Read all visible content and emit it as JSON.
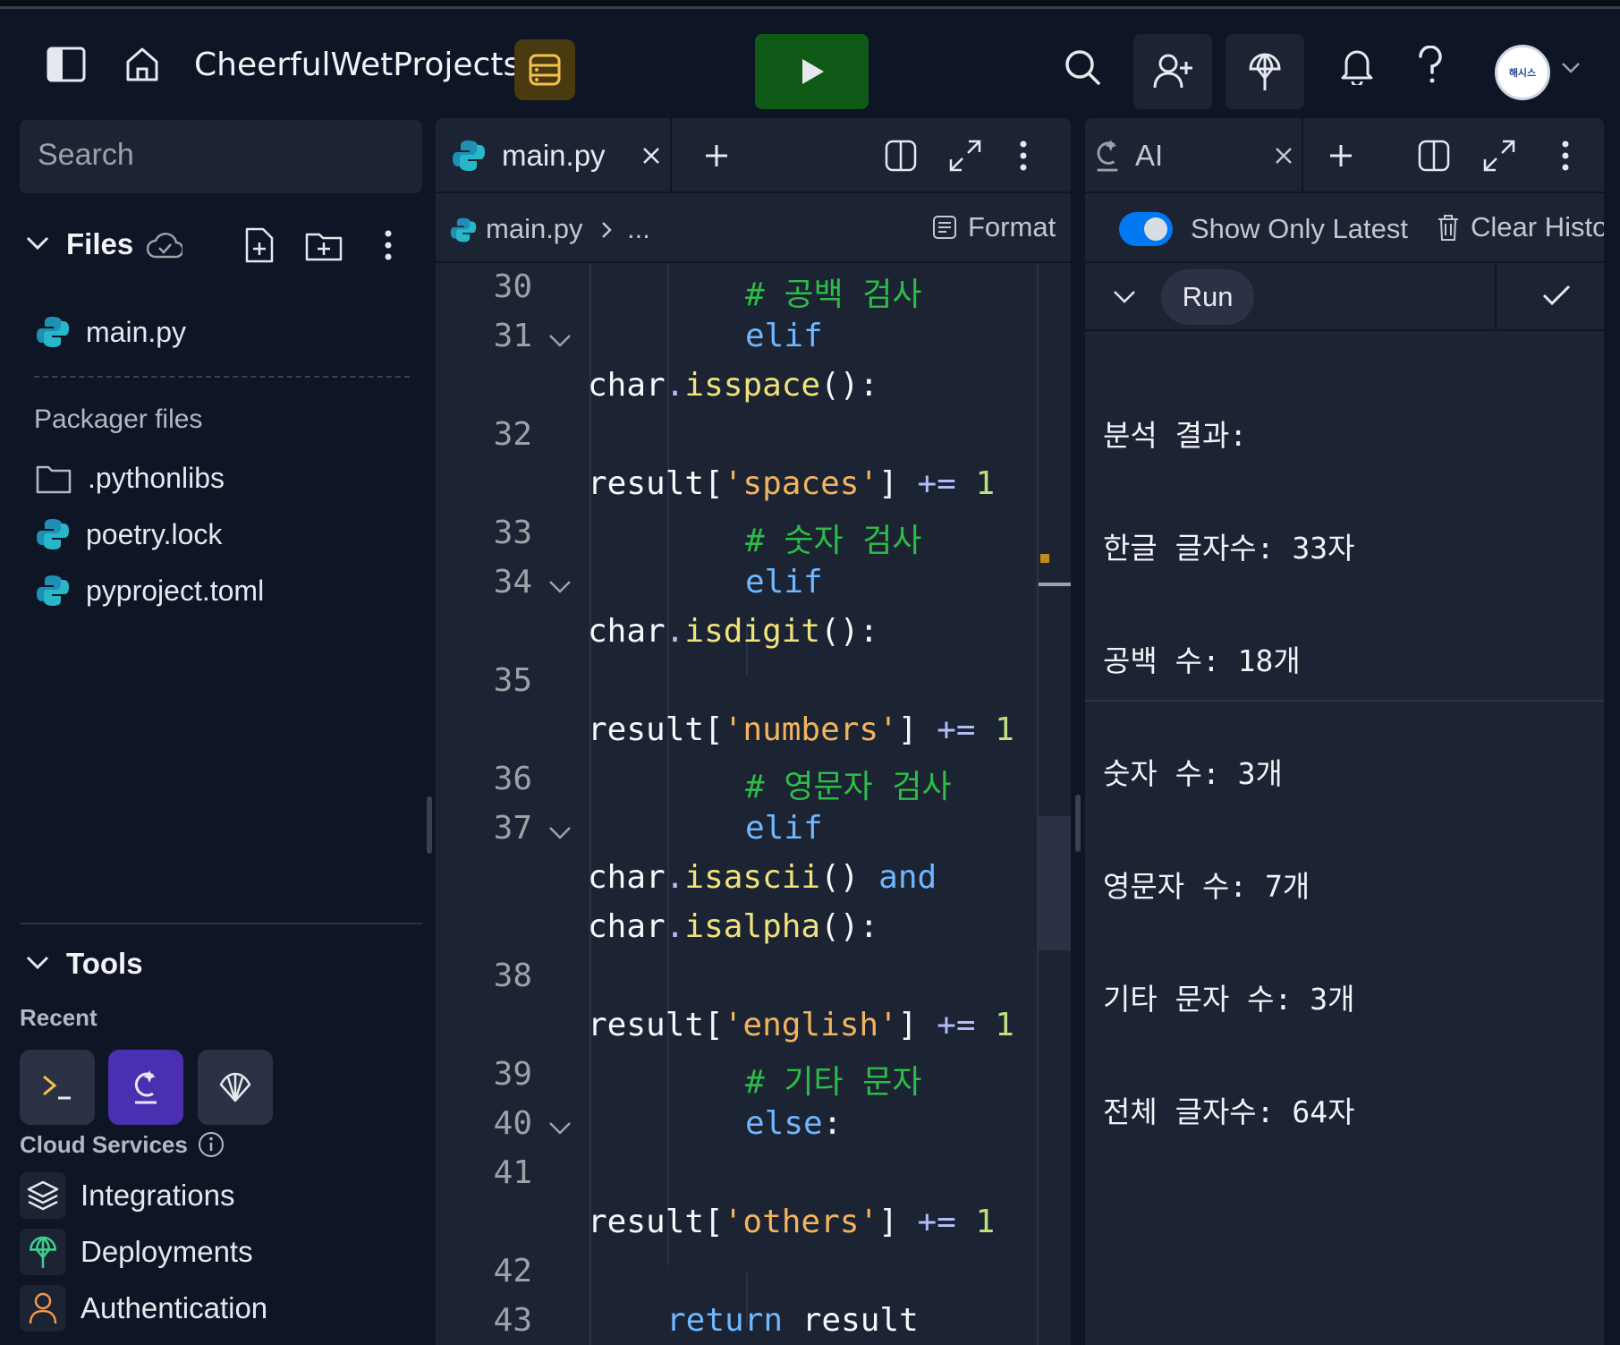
{
  "header": {
    "project_name": "CheerfulWetProjects",
    "avatar_text": "해시스"
  },
  "sidebar": {
    "search_placeholder": "Search",
    "files_title": "Files",
    "files": [
      {
        "name": "main.py"
      }
    ],
    "packager_title": "Packager files",
    "packager_files": [
      {
        "name": ".pythonlibs"
      },
      {
        "name": "poetry.lock"
      },
      {
        "name": "pyproject.toml"
      }
    ],
    "tools_title": "Tools",
    "recent_label": "Recent",
    "cloud_title": "Cloud Services",
    "services": [
      {
        "label": "Integrations"
      },
      {
        "label": "Deployments"
      },
      {
        "label": "Authentication"
      }
    ]
  },
  "editor": {
    "tab_label": "main.py",
    "breadcrumb_file": "main.py",
    "breadcrumb_rest": "...",
    "format_label": "Format",
    "lines": [
      {
        "num": "30",
        "text": "# 공백 검사"
      },
      {
        "num": "31",
        "text": "elif char.isspace():"
      },
      {
        "num": "32",
        "text": "result['spaces'] += 1"
      },
      {
        "num": "33",
        "text": "# 숫자 검사"
      },
      {
        "num": "34",
        "text": "elif char.isdigit():"
      },
      {
        "num": "35",
        "text": "result['numbers'] += 1"
      },
      {
        "num": "36",
        "text": "# 영문자 검사"
      },
      {
        "num": "37",
        "text": "elif char.isascii() and char.isalpha():"
      },
      {
        "num": "38",
        "text": "result['english'] += 1"
      },
      {
        "num": "39",
        "text": "# 기타 문자"
      },
      {
        "num": "40",
        "text": "else:"
      },
      {
        "num": "41",
        "text": "result['others'] += 1"
      },
      {
        "num": "42",
        "text": ""
      },
      {
        "num": "43",
        "text": "return result"
      }
    ]
  },
  "ai": {
    "tab_label": "AI",
    "show_latest_label": "Show Only Latest",
    "show_latest_on": true,
    "clear_label": "Clear Histo",
    "run_label": "Run",
    "output": [
      "분석 결과:",
      "한글 글자수: 33자",
      "공백 수: 18개",
      "숫자 수: 3개",
      "영문자 수: 7개",
      "기타 문자 수: 3개",
      "전체 글자수: 64자"
    ]
  },
  "colors": {
    "background": "#0e1525",
    "panel": "#1c2333",
    "run_button": "#0f5a17",
    "accent_blue": "#0079f2",
    "keyword": "#6fb7ff",
    "comment": "#2dbd47",
    "string": "#f2b45c"
  }
}
